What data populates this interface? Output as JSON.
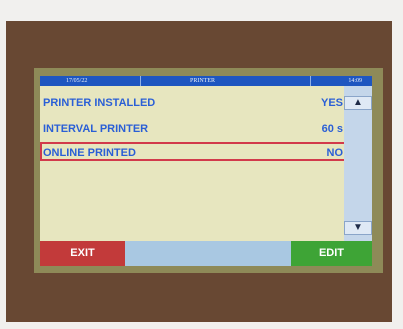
{
  "header": {
    "date": "17/05/22",
    "title": "PRINTER",
    "time": "14:09"
  },
  "rows": [
    {
      "label": "PRINTER INSTALLED",
      "value": "YES"
    },
    {
      "label": "INTERVAL PRINTER",
      "value": "60 s"
    },
    {
      "label": "ONLINE PRINTED",
      "value": "NO"
    }
  ],
  "buttons": {
    "exit": "EXIT",
    "edit": "EDIT"
  },
  "colors": {
    "header_bar": "#1e56c0",
    "row_text": "#2a5fd6",
    "selection_border": "#d23a4b",
    "exit_button": "#c23a3a",
    "edit_button": "#3ea436",
    "screen_background": "#e7e6bf"
  },
  "icons": {
    "scroll_up": "arrow-up-icon",
    "scroll_down": "arrow-down-icon"
  }
}
